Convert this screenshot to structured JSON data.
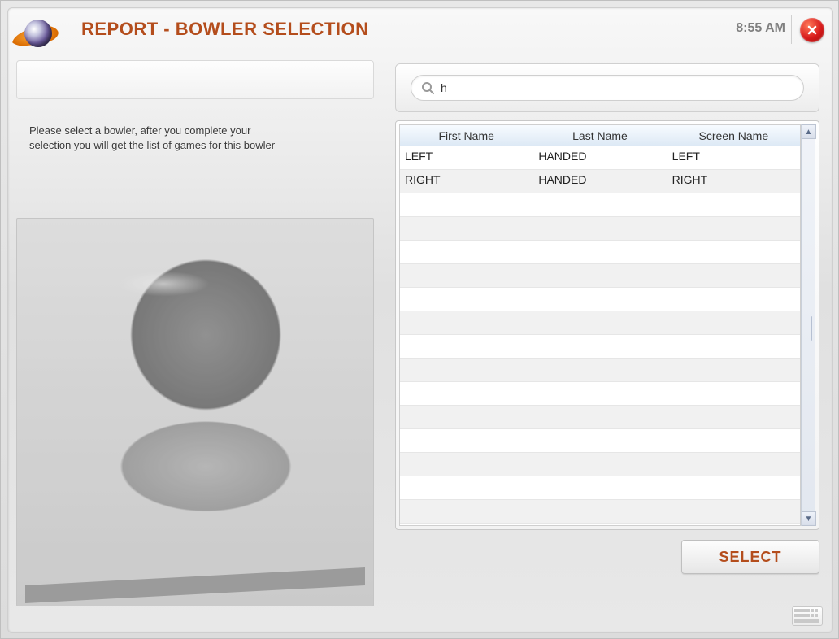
{
  "header": {
    "title": "REPORT - BOWLER SELECTION",
    "clock": "8:55 AM"
  },
  "left": {
    "instruction_line1": "Please select a bowler, after you complete your",
    "instruction_line2": "selection you will get the list of games for this bowler"
  },
  "search": {
    "value": "h",
    "placeholder": ""
  },
  "grid": {
    "columns": [
      "First Name",
      "Last Name",
      "Screen Name"
    ],
    "rows": [
      {
        "first": "LEFT",
        "last": "HANDED",
        "screen": "LEFT"
      },
      {
        "first": "RIGHT",
        "last": "HANDED",
        "screen": "RIGHT"
      },
      {
        "first": "",
        "last": "",
        "screen": ""
      },
      {
        "first": "",
        "last": "",
        "screen": ""
      },
      {
        "first": "",
        "last": "",
        "screen": ""
      },
      {
        "first": "",
        "last": "",
        "screen": ""
      },
      {
        "first": "",
        "last": "",
        "screen": ""
      },
      {
        "first": "",
        "last": "",
        "screen": ""
      },
      {
        "first": "",
        "last": "",
        "screen": ""
      },
      {
        "first": "",
        "last": "",
        "screen": ""
      },
      {
        "first": "",
        "last": "",
        "screen": ""
      },
      {
        "first": "",
        "last": "",
        "screen": ""
      },
      {
        "first": "",
        "last": "",
        "screen": ""
      },
      {
        "first": "",
        "last": "",
        "screen": ""
      },
      {
        "first": "",
        "last": "",
        "screen": ""
      },
      {
        "first": "",
        "last": "",
        "screen": ""
      }
    ]
  },
  "buttons": {
    "select": "SELECT"
  }
}
